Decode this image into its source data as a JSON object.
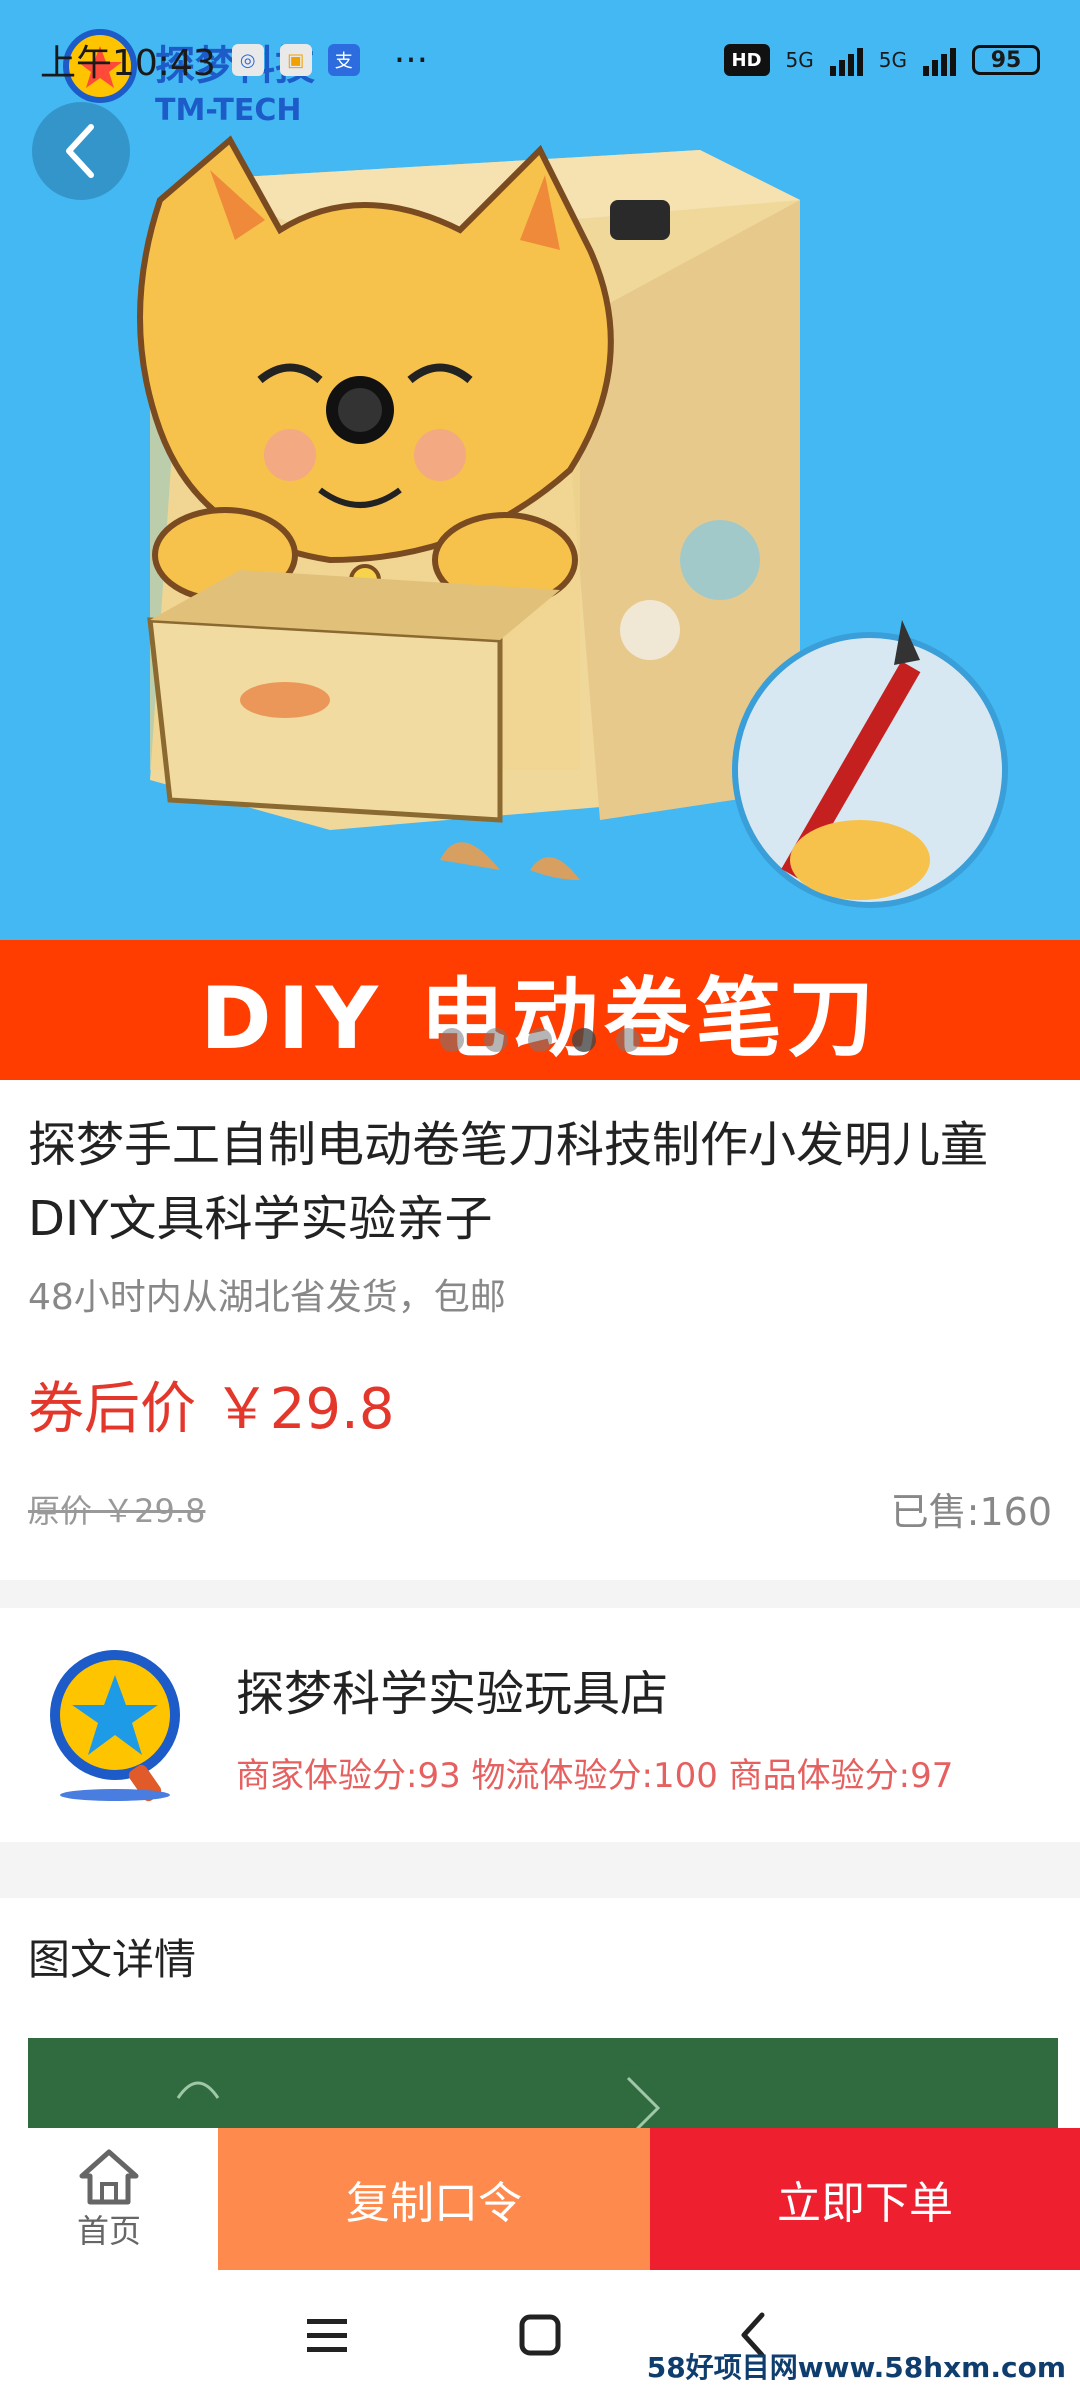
{
  "status_bar": {
    "time": "上午10:43",
    "more": "···",
    "network_1": "5G",
    "network_2": "5G",
    "battery": "95",
    "hd_label": "HD"
  },
  "hero": {
    "brand_text": "探梦科技",
    "brand_sub": "TM-TECH",
    "banner_text": "DIY 电动卷笔刀",
    "slide_count": 5,
    "active_slide": 4
  },
  "product": {
    "title": "探梦手工自制电动卷笔刀科技制作小发明儿童DIY文具科学实验亲子",
    "shipping": "48小时内从湖北省发货，包邮",
    "price_label": "券后价 ￥29.8",
    "original_price": "原价 ￥29.8",
    "sold": "已售:160"
  },
  "store": {
    "name": "探梦科学实验玩具店",
    "scores": "商家体验分:93  物流体验分:100  商品体验分:97"
  },
  "detail": {
    "title": "图文详情"
  },
  "actionbar": {
    "home_label": "首页",
    "copy_label": "复制口令",
    "buy_label": "立即下单"
  },
  "watermark": "58好项目网www.58hxm.com",
  "colors": {
    "hero_bg": "#43b8f2",
    "banner_bg": "#ff3d00",
    "price_red": "#e4372b",
    "copy_orange": "#ff8a4d",
    "buy_red": "#ee1f2f",
    "score_red": "#e66060"
  }
}
